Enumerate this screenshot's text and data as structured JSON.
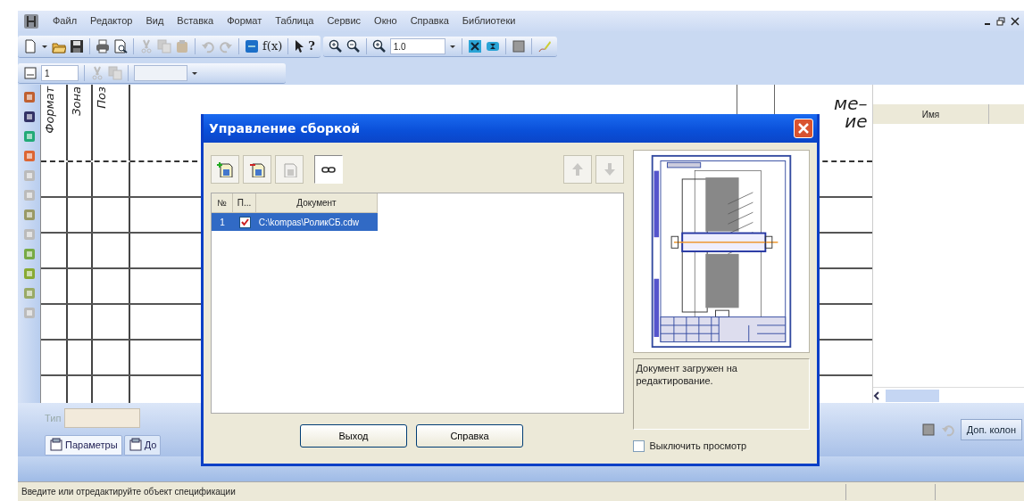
{
  "menu": [
    {
      "label": "Файл"
    },
    {
      "label": "Редактор"
    },
    {
      "label": "Вид"
    },
    {
      "label": "Вставка"
    },
    {
      "label": "Формат"
    },
    {
      "label": "Таблица"
    },
    {
      "label": "Сервис"
    },
    {
      "label": "Окно"
    },
    {
      "label": "Справка"
    },
    {
      "label": "Библиотеки"
    }
  ],
  "toolbar": {
    "formula": "f(x)",
    "help": "?",
    "zoom": "1.0"
  },
  "layer_bar": {
    "value": "1"
  },
  "spec_table": {
    "columns": [
      "Формат",
      "Зона",
      "Поз"
    ],
    "note_header": [
      "ме–",
      "ие"
    ]
  },
  "right_panel": {
    "columns": [
      "Имя"
    ]
  },
  "property_bar": {
    "type_label": "Тип",
    "tabs": [
      {
        "label": "Параметры",
        "selected": true
      },
      {
        "label": "До",
        "selected": false
      }
    ],
    "extra_columns_button": "Доп. колон"
  },
  "status_bar": {
    "text": "Введите или отредактируйте объект спецификации"
  },
  "dialog": {
    "title": "Управление сборкой",
    "tools": [
      {
        "kind": "add",
        "disabled": false
      },
      {
        "kind": "remove",
        "disabled": false
      },
      {
        "kind": "copy",
        "disabled": true
      },
      {
        "kind": "link",
        "disabled": false
      }
    ],
    "move": [
      {
        "kind": "up",
        "disabled": true
      },
      {
        "kind": "down",
        "disabled": true
      }
    ],
    "columns": [
      "№",
      "П...",
      "Документ"
    ],
    "rows": [
      {
        "number": "1",
        "checked": true,
        "document": "C:\\kompas\\РоликСБ.cdw",
        "selected": true
      }
    ],
    "message": "Документ загружен на редактирование.",
    "preview_toggle": {
      "label": "Выключить просмотр",
      "checked": false
    },
    "buttons": [
      "Выход",
      "Справка"
    ]
  }
}
